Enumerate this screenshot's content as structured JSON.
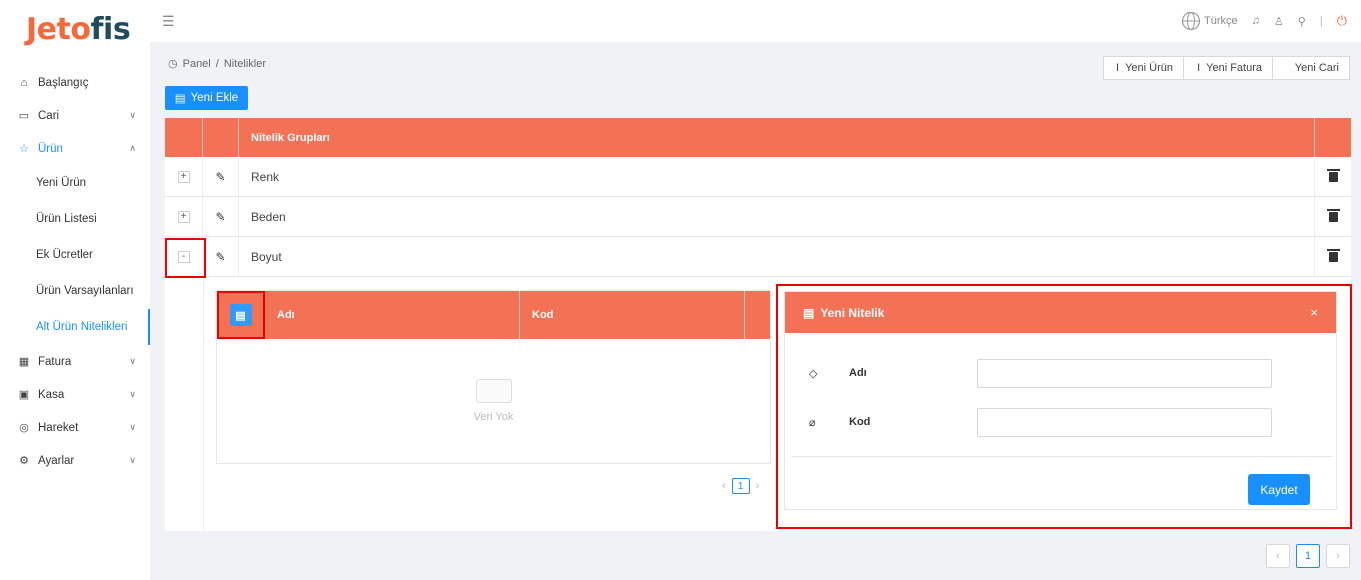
{
  "brand": {
    "logo_a": "Jet",
    "logo_b": "fis",
    "logo_o": "o"
  },
  "sidebar": {
    "items": [
      {
        "label": "Başlangıç",
        "icon": "home-icon"
      },
      {
        "label": "Cari",
        "icon": "contact-card-icon"
      },
      {
        "label": "Ürün",
        "icon": "star-icon"
      },
      {
        "label": "Fatura",
        "icon": "calculator-icon"
      },
      {
        "label": "Kasa",
        "icon": "wallet-icon"
      },
      {
        "label": "Hareket",
        "icon": "money-circle-icon"
      },
      {
        "label": "Ayarlar",
        "icon": "gear-icon"
      }
    ],
    "sub": [
      "Yeni Ürün",
      "Ürün Listesi",
      "Ek Ücretler",
      "Ürün Varsayılanları",
      "Alt Ürün Nitelikleri"
    ]
  },
  "topbar": {
    "language": "Türkçe"
  },
  "breadcrumb": {
    "root": "Panel",
    "sep": "/",
    "current": "Nitelikler"
  },
  "quick": [
    "Yeni Ürün",
    "Yeni Fatura",
    "Yeni Cari"
  ],
  "add_label": "Yeni Ekle",
  "table": {
    "header": "Nitelik Grupları",
    "rows": [
      {
        "name": "Renk",
        "toggle": "+"
      },
      {
        "name": "Beden",
        "toggle": "+"
      },
      {
        "name": "Boyut",
        "toggle": "-"
      }
    ]
  },
  "subtable": {
    "col_name": "Adı",
    "col_code": "Kod",
    "empty": "Veri Yok",
    "page": "1"
  },
  "modal": {
    "title": "Yeni Nitelik",
    "close": "×",
    "name_label": "Adı",
    "code_label": "Kod",
    "name_value": "",
    "code_value": "",
    "save": "Kaydet"
  },
  "pager": {
    "page": "1"
  },
  "colors": {
    "accent": "#f37255",
    "primary": "#1890ff",
    "highlight": "#e00000"
  }
}
